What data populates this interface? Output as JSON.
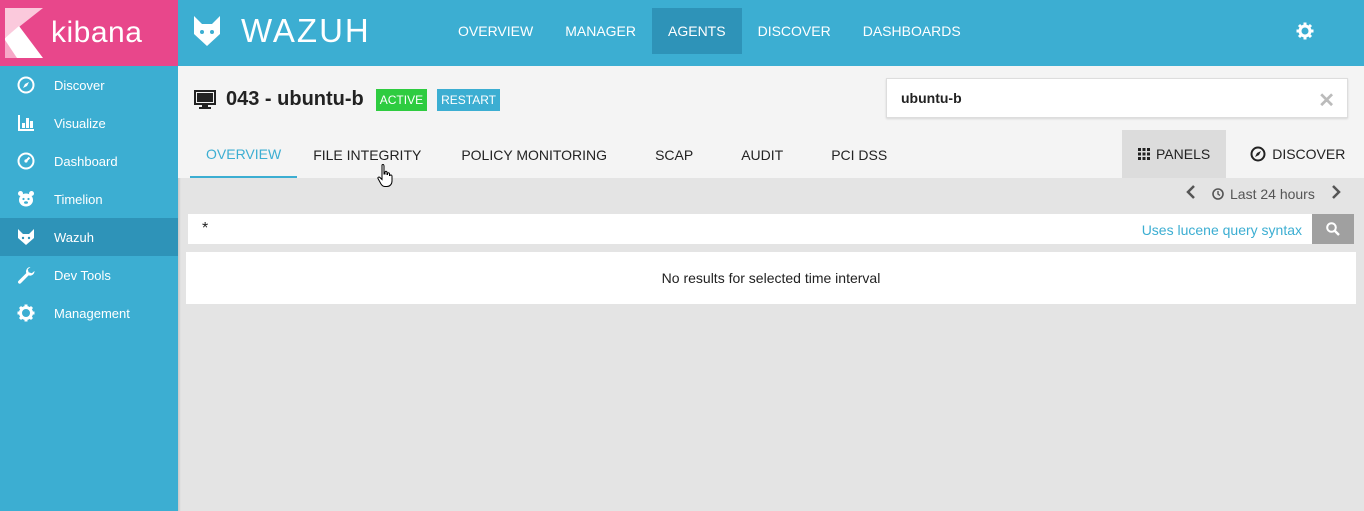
{
  "sidebar": {
    "brand": "kibana",
    "items": [
      {
        "label": "Discover",
        "icon": "compass-icon"
      },
      {
        "label": "Visualize",
        "icon": "bar-chart-icon"
      },
      {
        "label": "Dashboard",
        "icon": "gauge-icon"
      },
      {
        "label": "Timelion",
        "icon": "timelion-icon"
      },
      {
        "label": "Wazuh",
        "icon": "wazuh-icon"
      },
      {
        "label": "Dev Tools",
        "icon": "wrench-icon"
      },
      {
        "label": "Management",
        "icon": "gear-icon"
      }
    ],
    "active_item": "Wazuh"
  },
  "topbar": {
    "brand": "WAZUH",
    "tabs": [
      "OVERVIEW",
      "MANAGER",
      "AGENTS",
      "DISCOVER",
      "DASHBOARDS"
    ],
    "active_tab": "AGENTS",
    "settings_icon": "gear-icon"
  },
  "agent": {
    "title": "043 - ubuntu-b",
    "status": "ACTIVE",
    "restart_label": "RESTART",
    "search_value": "ubuntu-b",
    "clear_symbol": "✕"
  },
  "subtabs": {
    "items": [
      "OVERVIEW",
      "FILE INTEGRITY",
      "POLICY MONITORING",
      "SCAP",
      "AUDIT",
      "PCI DSS"
    ],
    "active": "OVERVIEW",
    "panels_label": "PANELS",
    "discover_label": "DISCOVER"
  },
  "timepicker": {
    "label": "Last 24 hours"
  },
  "query": {
    "value": "*",
    "syntax_link": "Uses lucene query syntax"
  },
  "results": {
    "message": "No results for selected time interval"
  },
  "colors": {
    "kibana_pink": "#e8478b",
    "wazuh_blue": "#3caed2",
    "active_blue": "#2e93b8",
    "active_green": "#2ecc40"
  }
}
